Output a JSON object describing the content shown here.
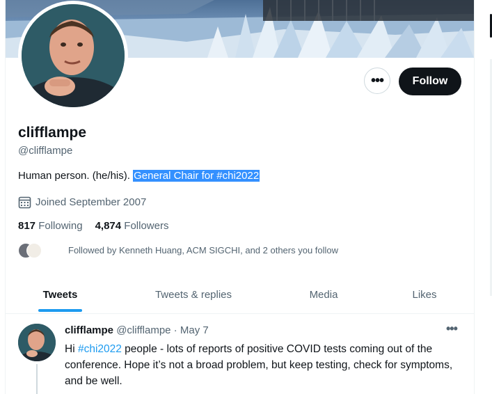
{
  "profile": {
    "display_name": "clifflampe",
    "handle": "@clifflampe",
    "bio_plain": "Human person. (he/his). ",
    "bio_highlight": "General Chair for #chi2022",
    "joined": "Joined September 2007",
    "following_count": "817",
    "following_label": "Following",
    "followers_count": "4,874",
    "followers_label": "Followers",
    "followed_by": "Followed by Kenneth Huang, ACM SIGCHI, and 2 others you follow"
  },
  "actions": {
    "more_label": "•••",
    "follow_label": "Follow"
  },
  "tabs": [
    {
      "label": "Tweets"
    },
    {
      "label": "Tweets & replies"
    },
    {
      "label": "Media"
    },
    {
      "label": "Likes"
    }
  ],
  "tweet": {
    "author": "clifflampe",
    "handle": "@clifflampe",
    "separator": " · ",
    "date": "May 7",
    "more": "•••",
    "text_before": "Hi ",
    "hashtag": "#chi2022",
    "text_after": " people - lots of reports of positive COVID tests coming out of the conference. Hope it’s not a broad problem, but keep testing, check for symptoms, and be well."
  },
  "colors": {
    "accent": "#1d9bf0",
    "follow_button": "#0f1419",
    "selection": "#3390ff"
  },
  "icons": [
    "more-icon",
    "calendar-icon"
  ]
}
